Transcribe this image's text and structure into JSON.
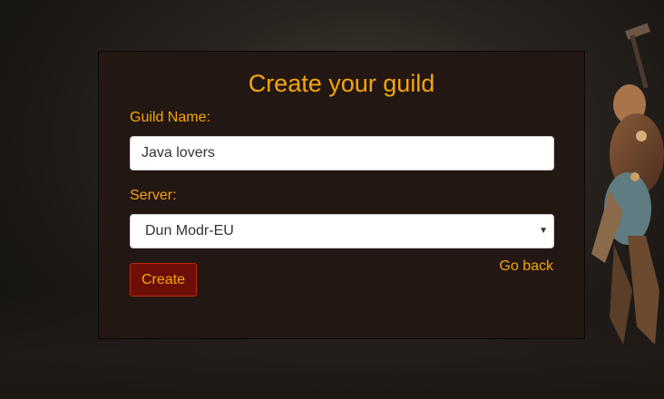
{
  "form": {
    "title": "Create your guild",
    "guild_name_label": "Guild Name:",
    "guild_name_value": "Java lovers",
    "server_label": "Server:",
    "server_selected": "Dun Modr-EU",
    "create_label": "Create",
    "go_back_label": "Go back"
  },
  "colors": {
    "accent": "#f5a60b",
    "panel_bg": "#231713",
    "button_bg": "#6d0f07",
    "button_border": "#c0290f"
  },
  "icons": {
    "select_arrow": "chevron-down-icon"
  }
}
